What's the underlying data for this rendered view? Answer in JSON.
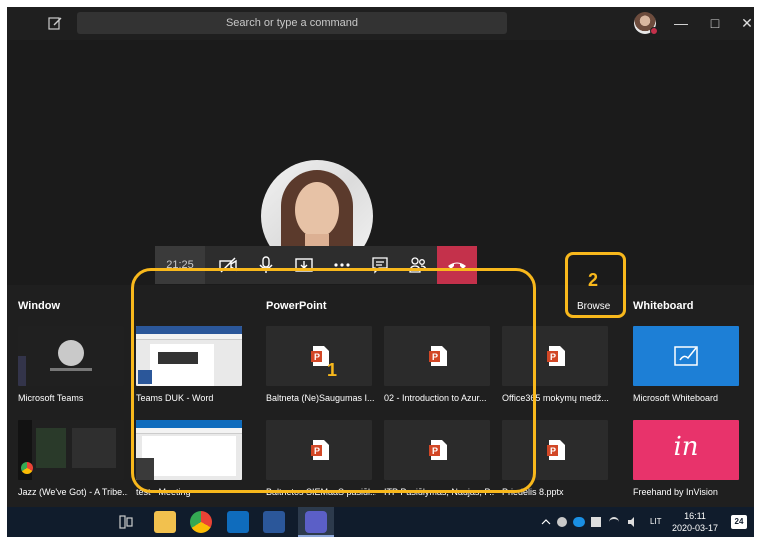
{
  "header": {
    "search_placeholder": "Search or type a command",
    "minimize": "—",
    "maximize": "□",
    "close": "✕"
  },
  "call": {
    "duration": "21:25"
  },
  "tray": {
    "window_title": "Window",
    "powerpoint_title": "PowerPoint",
    "browse_label": "Browse",
    "whiteboard_title": "Whiteboard",
    "windows": [
      {
        "label": "Microsoft Teams"
      },
      {
        "label": "Jazz (We've Got) - A Tribe..."
      }
    ],
    "docs": [
      {
        "label": "Teams DUK - Word"
      },
      {
        "label": "test - Meeting"
      }
    ],
    "powerpoint": [
      {
        "label": "Baltneta (Ne)Saugumas I..."
      },
      {
        "label": "02 - Introduction to Azur..."
      },
      {
        "label": "Office365 mokymų medž..."
      },
      {
        "label": "Baltnetos SIEMaaS pasiūl..."
      },
      {
        "label": "ITP Pasiūlymas, Naujas, P..."
      },
      {
        "label": "Priedėlis 8.pptx"
      }
    ],
    "whiteboards": [
      {
        "label": "Microsoft Whiteboard"
      },
      {
        "label": "Freehand by InVision",
        "glyph": "in"
      }
    ]
  },
  "annotations": {
    "one": "1",
    "two": "2"
  },
  "taskbar": {
    "lang": "LIT",
    "time": "16:11",
    "date": "2020-03-17",
    "notifications": "24"
  },
  "colors": {
    "accent": "#f8b81c",
    "hangup": "#c4314b",
    "whiteboard": "#1d7fd6",
    "invision": "#e8336b",
    "ppt": "#d24726"
  }
}
